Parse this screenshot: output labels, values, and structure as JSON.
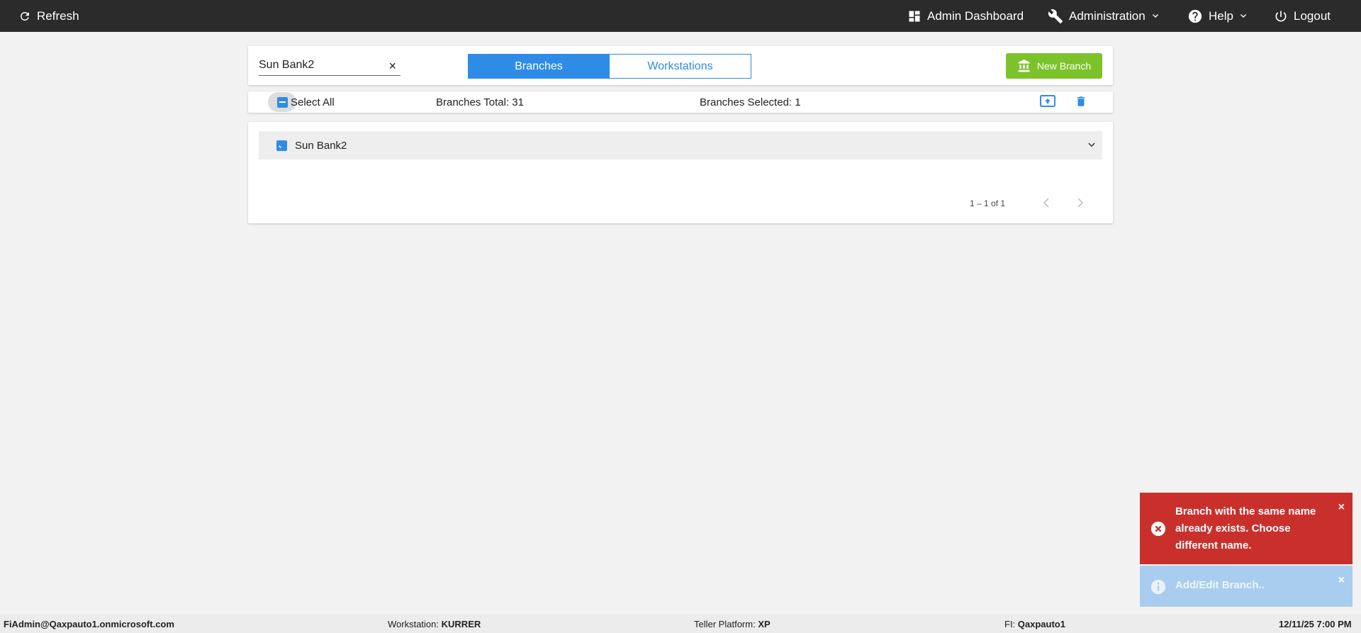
{
  "topbar": {
    "refresh_label": "Refresh",
    "admin_dashboard_label": "Admin Dashboard",
    "administration_label": "Administration",
    "help_label": "Help",
    "logout_label": "Logout"
  },
  "search": {
    "value": "Sun Bank2",
    "clear_glyph": "×"
  },
  "tabs": {
    "branches_label": "Branches",
    "workstations_label": "Workstations",
    "active": "Branches"
  },
  "new_branch_label": "New Branch",
  "toolbar": {
    "select_all_label": "Select All",
    "branches_total_label": "Branches Total: 31",
    "branches_selected_label": "Branches Selected: 1"
  },
  "branches": [
    {
      "name": "Sun Bank2",
      "selected": true
    }
  ],
  "pagination": {
    "range_label": "1 – 1 of 1"
  },
  "toasts": {
    "error_message": "Branch with the same name already exists. Choose different name.",
    "info_message": "Add/Edit Branch..",
    "close_glyph": "×"
  },
  "footer": {
    "user": "FiAdmin@Qaxpauto1.onmicrosoft.com",
    "workstation_label": "Workstation:",
    "workstation_value": "KURRER",
    "teller_platform_label": "Teller Platform:",
    "teller_platform_value": "XP",
    "fi_label": "FI:",
    "fi_value": "Qaxpauto1",
    "datetime": "12/11/25 7:00 PM"
  },
  "colors": {
    "topbar": "#2b2b2b",
    "accent_blue": "#2f8ce6",
    "new_branch_green": "#7cc22b",
    "error_red": "#c9302c",
    "info_blue": "#a9cdee"
  }
}
